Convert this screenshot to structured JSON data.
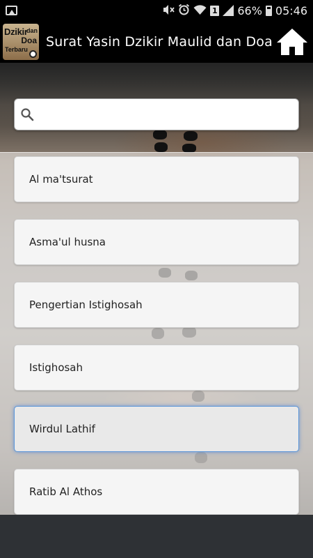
{
  "status_bar": {
    "battery_percent": "66%",
    "time": "05:46",
    "sim_slot": "1",
    "icons": [
      "image-icon",
      "mute-icon",
      "alarm-icon",
      "wifi-icon",
      "sim-icon",
      "signal-icon",
      "battery-icon"
    ]
  },
  "app_bar": {
    "title": "Surat Yasin Dzikir Maulid dan Doa",
    "logo": {
      "line1": "Dzikir",
      "line2": "dan",
      "line3": "Doa",
      "line4": "Terbaru"
    },
    "home_icon": "home-icon"
  },
  "search": {
    "placeholder": "",
    "value": "",
    "icon": "search-icon"
  },
  "menu": {
    "selected_index": 4,
    "items": [
      {
        "label": "Al ma'tsurat"
      },
      {
        "label": "Asma'ul husna"
      },
      {
        "label": "Pengertian Istighosah"
      },
      {
        "label": "Istighosah"
      },
      {
        "label": "Wirdul Lathif"
      },
      {
        "label": "Ratib Al Athos"
      }
    ]
  },
  "colors": {
    "app_bar": "#000000",
    "selected_border": "#5b95d6",
    "item_background": "#f5f5f5"
  }
}
